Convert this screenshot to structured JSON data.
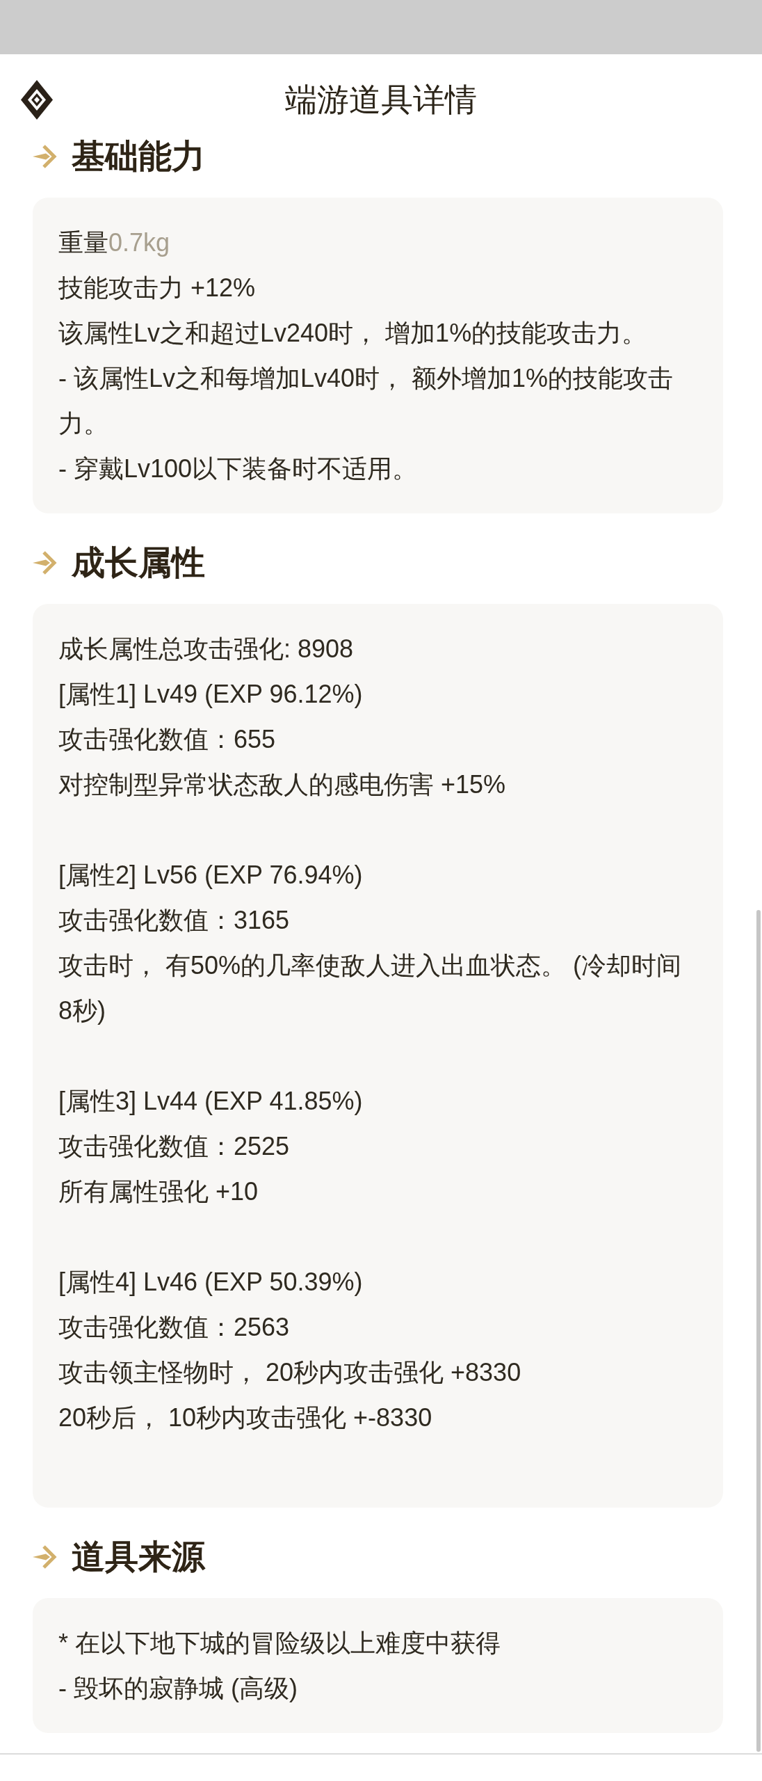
{
  "header": {
    "title": "端游道具详情"
  },
  "basic": {
    "heading": "基础能力",
    "weight": {
      "label": "重量",
      "value": "0.7kg"
    },
    "lines": [
      "技能攻击力 +12%",
      "该属性Lv之和超过Lv240时， 增加1%的技能攻击力。",
      "- 该属性Lv之和每增加Lv40时， 额外增加1%的技能攻击力。",
      "- 穿戴Lv100以下装备时不适用。"
    ]
  },
  "growth": {
    "heading": "成长属性",
    "total": "成长属性总攻击强化: 8908",
    "attributes": [
      {
        "header": "[属性1] Lv49 (EXP 96.12%)",
        "value": "攻击强化数值：655",
        "effects": [
          "对控制型异常状态敌人的感电伤害 +15%"
        ]
      },
      {
        "header": "[属性2] Lv56 (EXP 76.94%)",
        "value": "攻击强化数值：3165",
        "effects": [
          "攻击时， 有50%的几率使敌人进入出血状态。 (冷却时间8秒)"
        ]
      },
      {
        "header": "[属性3] Lv44 (EXP 41.85%)",
        "value": "攻击强化数值：2525",
        "effects": [
          "所有属性强化 +10"
        ]
      },
      {
        "header": "[属性4] Lv46 (EXP 50.39%)",
        "value": "攻击强化数值：2563",
        "effects": [
          "攻击领主怪物时， 20秒内攻击强化 +8330",
          "20秒后， 10秒内攻击强化 +-8330"
        ]
      }
    ]
  },
  "source": {
    "heading": "道具来源",
    "lines": [
      "* 在以下地下城的冒险级以上难度中获得",
      "- 毁坏的寂静城 (高级)"
    ]
  }
}
